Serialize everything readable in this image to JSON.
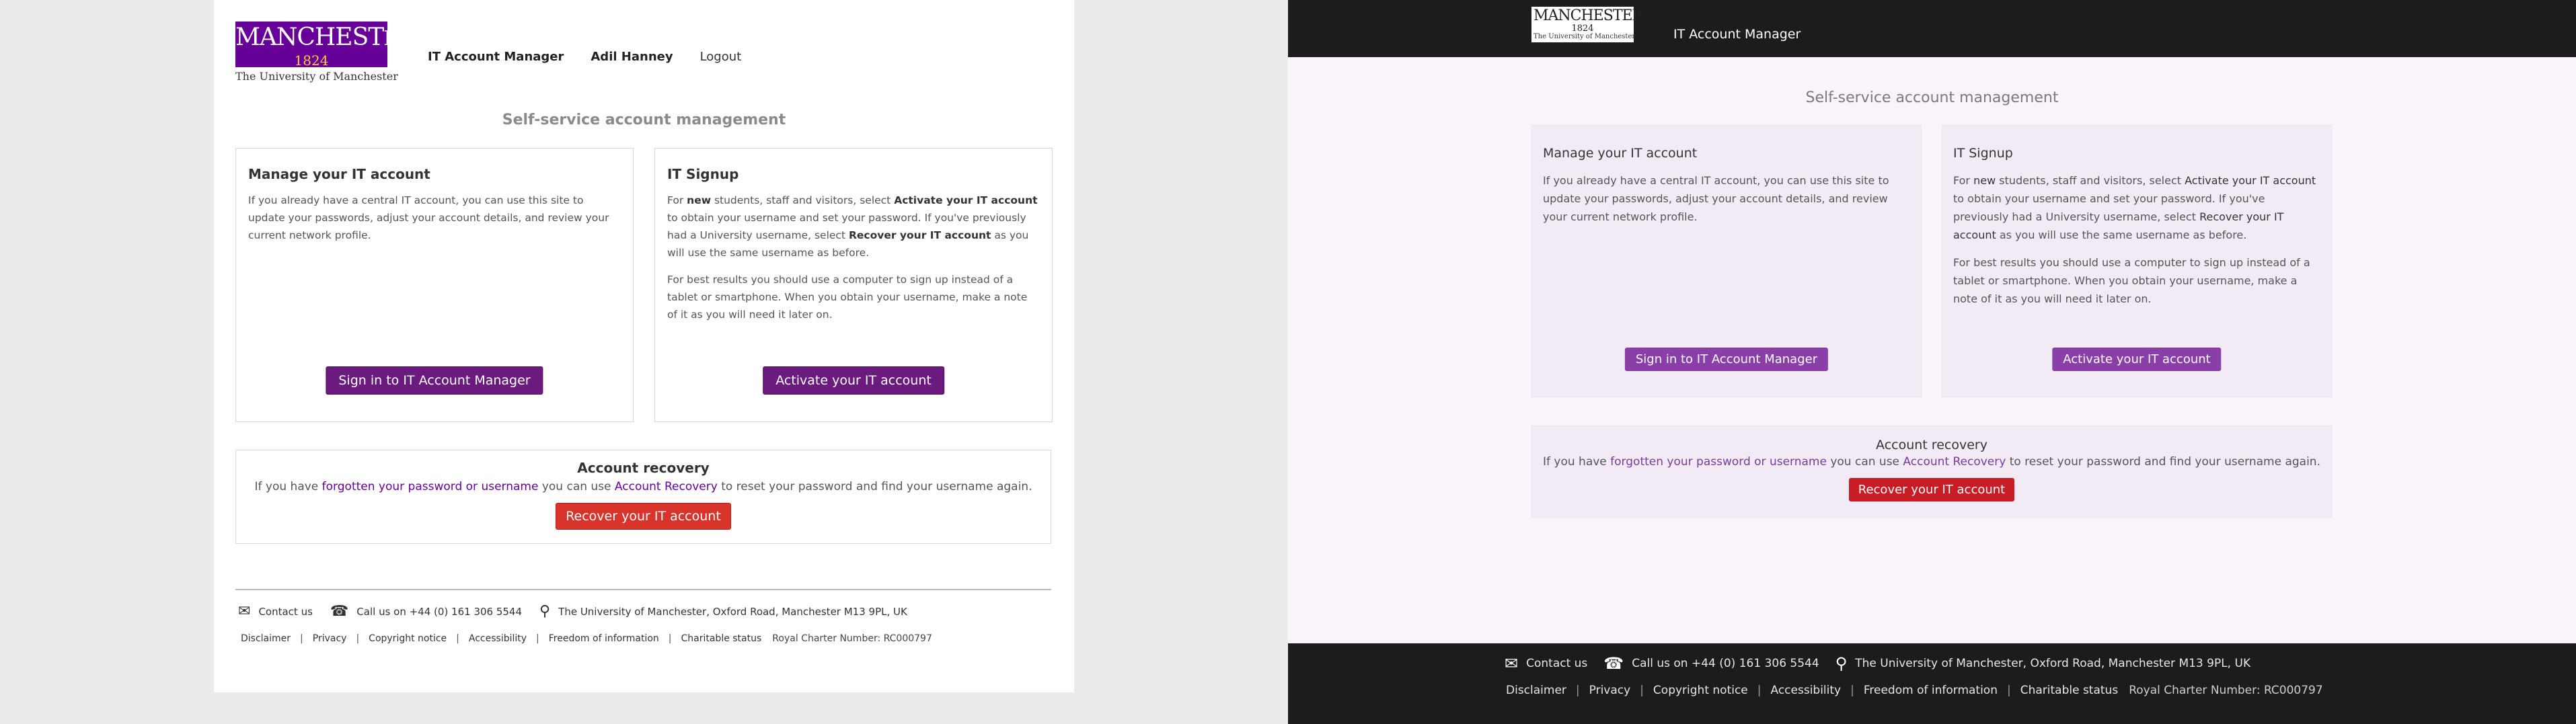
{
  "logo": {
    "name_main": "MANCHEST",
    "name_small": "ER",
    "year": "1824",
    "subtitle": "The University of Manchester"
  },
  "left_view": {
    "nav": {
      "app_link": "IT Account Manager",
      "user_name": "Adil Hanney",
      "logout": "Logout"
    },
    "heading": "Self-service account management"
  },
  "right_view": {
    "app_title": "IT Account Manager",
    "heading": "Self-service account management"
  },
  "manage_card": {
    "title": "Manage your IT account",
    "text": "If you already have a central IT account, you can use this site to update your passwords, adjust your account details, and review your current network profile.",
    "button": "Sign in to IT Account Manager"
  },
  "signup_card": {
    "title": "IT Signup",
    "p1_a": "For ",
    "p1_new": "new",
    "p1_b": " students, staff and visitors, select ",
    "p1_activate": "Activate your IT account",
    "p1_c": " to obtain your username and set your password. If you've previously had a University username, select ",
    "p1_recover": "Recover your IT account",
    "p1_d": " as you will use the same username as before.",
    "p2": "For best results you should use a computer to sign up instead of a tablet or smartphone. When you obtain your username, make a note of it as you will need it later on.",
    "button": "Activate your IT account"
  },
  "recovery": {
    "title": "Account recovery",
    "text_a": "If you have ",
    "link_forgotten": "forgotten your password or username",
    "text_b": " you can use ",
    "link_recovery": "Account Recovery",
    "text_c": " to reset your password and find your username again.",
    "button": "Recover your IT account"
  },
  "footer": {
    "contact": "Contact us",
    "phone": "Call us on +44 (0) 161 306 5544",
    "address": "The University of Manchester, Oxford Road, Manchester M13 9PL, UK",
    "links": [
      "Disclaimer",
      "Privacy",
      "Copyright notice",
      "Accessibility",
      "Freedom of information",
      "Charitable status"
    ],
    "royal_charter": "Royal Charter Number: RC000797"
  },
  "icons": {
    "envelope": "envelope-icon",
    "phone": "phone-icon",
    "location": "map-marker-icon"
  },
  "colors": {
    "brand_purple": "#660099",
    "button_purple": "#6a1b7d",
    "button_purple_light": "#8a3fa8",
    "button_red": "#d9342b",
    "dark_header": "#1d1b1e"
  }
}
